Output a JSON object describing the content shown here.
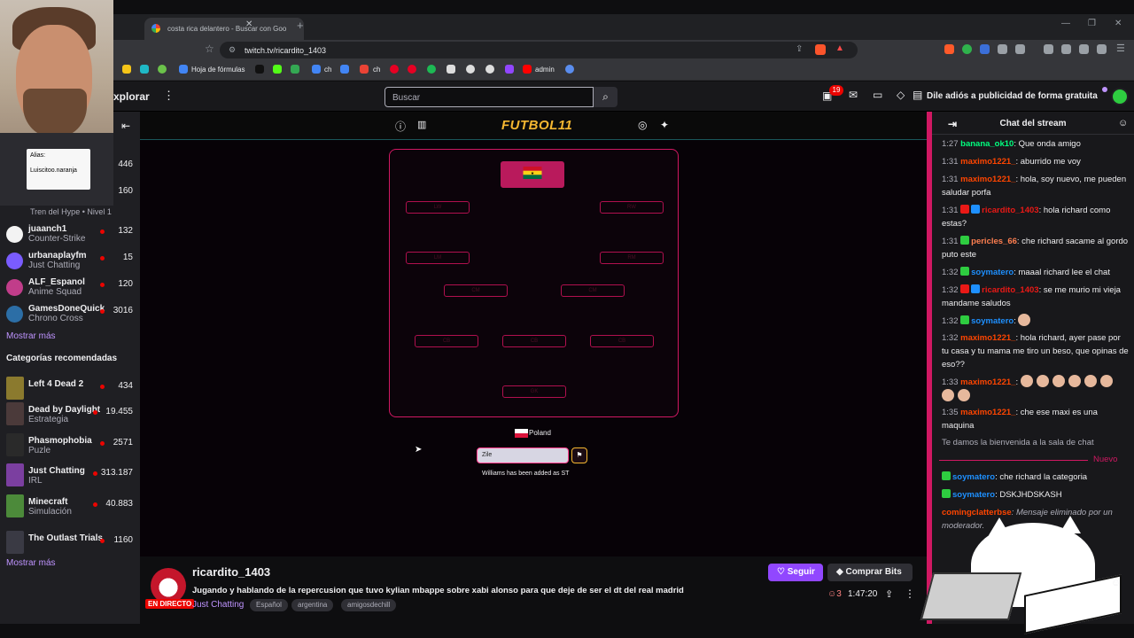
{
  "browser": {
    "tab_title": "costa rica delantero - Buscar con Goo",
    "url": "twitch.tv/ricardito_1403",
    "bookmarks": [
      "Hoja de fórmulas",
      "ch",
      "ch",
      "admin"
    ]
  },
  "webcam": {
    "card_label": "Alias:",
    "card_value": "Luiscitoo.naranja"
  },
  "topnav": {
    "explorar": "xplorar",
    "search_placeholder": "Buscar",
    "notif_count": "19",
    "ad_text": "Dile adiós a publicidad de forma gratuita"
  },
  "sidebar": {
    "partial_rows": [
      {
        "viewers": "446"
      },
      {
        "viewers": "160",
        "game": "Tren del Hype • Nivel 1"
      }
    ],
    "channels": [
      {
        "name": "juaanch1",
        "game": "Counter-Strike",
        "viewers": "132",
        "color": "#f3f3f3"
      },
      {
        "name": "urbanaplayfm",
        "game": "Just Chatting",
        "viewers": "15",
        "color": "#7a5cff"
      },
      {
        "name": "ALF_Espanol",
        "game": "Anime Squad",
        "viewers": "120",
        "color": "#c13d8a"
      },
      {
        "name": "GamesDoneQuick",
        "game": "Chrono Cross",
        "viewers": "3016",
        "color": "#2c6ea6"
      }
    ],
    "more1": "Mostrar más",
    "categories_title": "Categorías recomendadas",
    "categories": [
      {
        "name": "Left 4 Dead 2",
        "tag": "",
        "viewers": "434",
        "color": "#8b7a2e"
      },
      {
        "name": "Dead by Daylight",
        "tag": "Estrategia",
        "viewers": "19.455",
        "color": "#4b3a3a"
      },
      {
        "name": "Phasmophobia",
        "tag": "Puzle",
        "viewers": "2571",
        "color": "#2a2a2a"
      },
      {
        "name": "Just Chatting",
        "tag": "IRL",
        "viewers": "313.187",
        "color": "#7b3fa0"
      },
      {
        "name": "Minecraft",
        "tag": "Simulación",
        "viewers": "40.883",
        "color": "#4c8a3a"
      },
      {
        "name": "The Outlast Trials",
        "tag": "",
        "viewers": "1160",
        "color": "#3a3a44"
      }
    ],
    "more2": "Mostrar más"
  },
  "game": {
    "logo": "FUTBOL11",
    "slots": [
      "LW",
      "RW",
      "LM",
      "RM",
      "CM",
      "CM",
      "CB",
      "CB",
      "CB",
      "GK"
    ],
    "country": "Poland",
    "input_value": "Zile",
    "status": "Williams has been added as ST"
  },
  "stream": {
    "name": "ricardito_1403",
    "live": "EN DIRECTO",
    "title": "Jugando y hablando de la repercusion que tuvo kylian mbappe sobre xabi alonso para que deje de ser el dt del real madrid",
    "game": "Just Chatting",
    "tags": [
      "Español",
      "argentina",
      "amigosdechill"
    ],
    "follow": "Seguir",
    "bits": "Comprar Bits",
    "viewers": "3",
    "uptime": "1:47:20"
  },
  "chat": {
    "title": "Chat del stream",
    "messages": [
      {
        "time": "1:27",
        "user": "banana_ok10",
        "color": "#00ff7f",
        "text": ": Que onda amigo"
      },
      {
        "time": "1:31",
        "user": "maximo1221_",
        "color": "#ff4500",
        "text": ": aburrido me voy"
      },
      {
        "time": "1:31",
        "user": "maximo1221_",
        "color": "#ff4500",
        "text": ": hola, soy nuevo, me pueden saludar porfa"
      },
      {
        "time": "1:31",
        "user": "ricardito_1403",
        "color": "#e91916",
        "text": ": hola richard como estas?"
      },
      {
        "time": "1:31",
        "user": "pericles_66",
        "color": "#ff7f50",
        "text": ": che richard sacame al gordo puto este"
      },
      {
        "time": "1:32",
        "user": "soymatero",
        "color": "#1e90ff",
        "text": ": maaal richard lee el chat"
      },
      {
        "time": "1:32",
        "user": "ricardito_1403",
        "color": "#e91916",
        "text": ": se me murio mi vieja mandame saludos"
      },
      {
        "time": "1:32",
        "user": "soymatero",
        "color": "#1e90ff",
        "text": ":"
      },
      {
        "time": "1:32",
        "user": "maximo1221_",
        "color": "#ff4500",
        "text": ": hola richard, ayer pase por tu casa y tu mama me tiro un beso, que opinas de eso??"
      },
      {
        "time": "1:33",
        "user": "maximo1221_",
        "color": "#ff4500",
        "text": ":"
      },
      {
        "time": "1:35",
        "user": "maximo1221_",
        "color": "#ff4500",
        "text": ": che ese maxi es una maquina"
      }
    ],
    "welcome": "Te damos la bienvenida a la sala de chat",
    "nuevo": "Nuevo",
    "after": [
      {
        "user": "soymatero",
        "color": "#1e90ff",
        "text": ": che richard la categoria"
      },
      {
        "user": "soymatero",
        "color": "#1e90ff",
        "text": ": DSKJHDSKASH"
      },
      {
        "user": "comingclatterbse",
        "color": "#ff4500",
        "text": ": Mensaje eliminado por un moderador."
      }
    ]
  }
}
